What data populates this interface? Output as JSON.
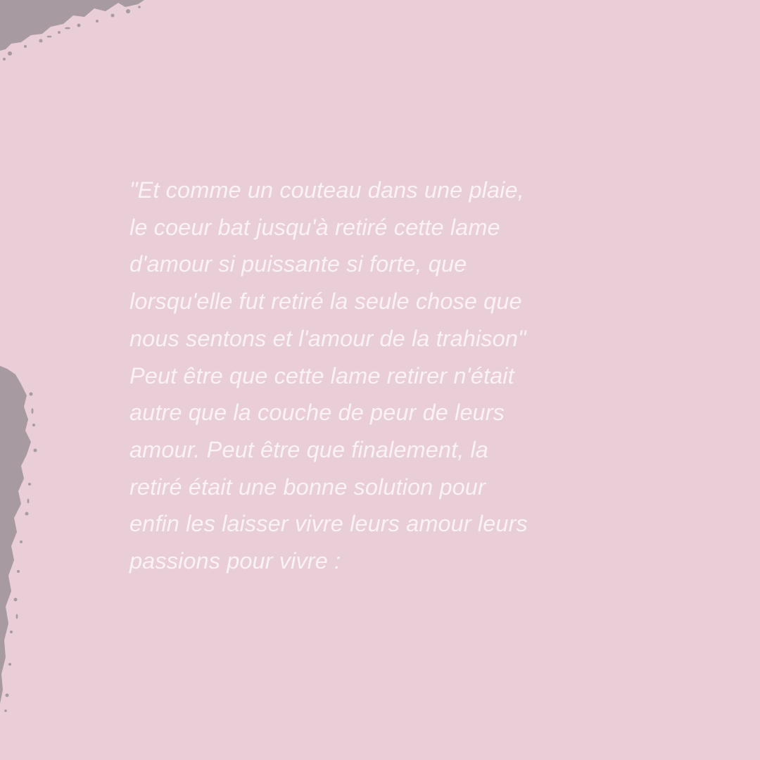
{
  "colors": {
    "background": "#e9cdd7",
    "text": "#fbf2f5",
    "brush_stroke": "#a89aa1"
  },
  "quote": {
    "lines": [
      "\"Et comme un couteau dans une plaie,",
      "le coeur bat jusqu'à retiré cette lame",
      "d'amour si puissante si forte, que",
      "lorsqu'elle fut retiré la seule chose que",
      "nous sentons et l'amour de la trahison\"",
      "Peut être que cette lame retirer n'était",
      "autre que la couche de peur de leurs",
      "amour. Peut être que finalement, la",
      "retiré était une bonne solution pour",
      "enfin les laisser vivre leurs amour leurs",
      "passions pour vivre :"
    ]
  }
}
